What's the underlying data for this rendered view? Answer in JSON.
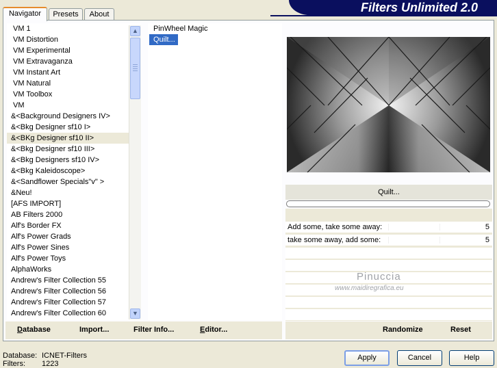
{
  "window": {
    "title": "Filters Unlimited 2.0"
  },
  "tabs": [
    {
      "label": "Navigator",
      "active": true
    },
    {
      "label": "Presets",
      "active": false
    },
    {
      "label": "About",
      "active": false
    }
  ],
  "categories": [
    "VM 1",
    "VM Distortion",
    "VM Experimental",
    "VM Extravaganza",
    "VM Instant Art",
    "VM Natural",
    "VM Toolbox",
    "VM",
    "&<Background Designers IV>",
    "&<Bkg Designer sf10 I>",
    "&<BKg Designer sf10 II>",
    "&<Bkg Designer sf10 III>",
    "&<Bkg Designers sf10 IV>",
    "&<Bkg Kaleidoscope>",
    "&<Sandflower Specials\"v\" >",
    "&Neu!",
    "[AFS IMPORT]",
    "AB Filters 2000",
    "Alf's Border FX",
    "Alf's Power Grads",
    "Alf's Power Sines",
    "Alf's Power Toys",
    "AlphaWorks",
    "Andrew's Filter Collection 55",
    "Andrew's Filter Collection 56",
    "Andrew's Filter Collection 57",
    "Andrew's Filter Collection 60"
  ],
  "selected_category": "&<BKg Designer sf10 II>",
  "filters": [
    "PinWheel Magic",
    "Quilt..."
  ],
  "selected_filter": "Quilt...",
  "preview": {
    "filter_name": "Quilt..."
  },
  "params": [
    {
      "label": "Add some, take some away:",
      "value": "5"
    },
    {
      "label": "take some away, add some:",
      "value": "5"
    }
  ],
  "watermark": {
    "line1": "Pinuccia",
    "line2": "www.maidiregrafica.eu"
  },
  "left_buttons": {
    "database": "Database",
    "import": "Import...",
    "filter_info": "Filter Info...",
    "editor": "Editor..."
  },
  "right_buttons": {
    "randomize": "Randomize",
    "reset": "Reset"
  },
  "status": {
    "database_label": "Database:",
    "database_value": "ICNET-Filters",
    "filters_label": "Filters:",
    "filters_value": "1223"
  },
  "dialog_buttons": {
    "apply": "Apply",
    "cancel": "Cancel",
    "help": "Help"
  },
  "colors": {
    "banner": "#0a0f5e",
    "selection": "#316ac5",
    "face": "#ece9d8"
  }
}
